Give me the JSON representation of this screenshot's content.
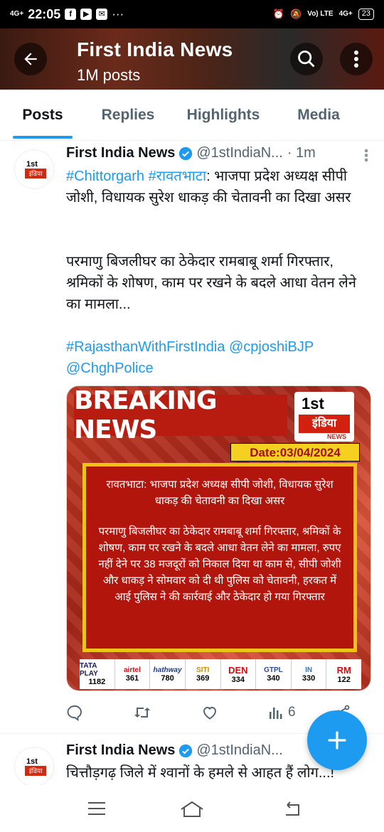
{
  "status_bar": {
    "network": "4G+",
    "time": "22:05",
    "right_network": "4G+",
    "volte": "Vo) LTE",
    "battery": "23"
  },
  "header": {
    "title": "First India News",
    "subtitle": "1M posts"
  },
  "tabs": [
    {
      "label": "Posts",
      "active": true
    },
    {
      "label": "Replies",
      "active": false
    },
    {
      "label": "Highlights",
      "active": false
    },
    {
      "label": "Media",
      "active": false
    }
  ],
  "tweet1": {
    "name": "First India News",
    "handle": "@1stIndiaN...",
    "time": "· 1m",
    "line1_tags": "#Chittorgarh #रावतभाटा",
    "line1_rest": ": भाजपा प्रदेश अध्यक्ष सीपी जोशी, विधायक सुरेश धाकड़ की चेतावनी का दिखा असर",
    "para2": "परमाणु बिजलीघर का ठेकेदार रामबाबू शर्मा गिरफ्तार, श्रमिकों के शोषण, काम पर रखने के बदले आधा वेतन लेने का मामला...",
    "hashtag3": "#RajasthanWithFirstIndia",
    "mention1": "@cpjoshiBJP",
    "mention2": "@ChghPolice",
    "views": "6"
  },
  "media": {
    "breaking": "BREAKING NEWS",
    "logo_1st": "1st",
    "logo_india": "इंडिया",
    "logo_news": "NEWS",
    "date": "Date:03/04/2024",
    "para1": "रावतभाटा: भाजपा प्रदेश अध्यक्ष सीपी जोशी, विधायक सुरेश धाकड़ की चेतावनी का दिखा असर",
    "para2": "परमाणु बिजलीघर का ठेकेदार रामबाबू शर्मा गिरफ्तार, श्रमिकों के शोषण, काम पर रखने के बदले आधा वेतन लेने का मामला, रुपए नहीं देने पर 38 मजदूरों को निकाल दिया था काम से, सीपी जोशी और धाकड़ ने सोमवार को दी थी पुलिस को चेतावनी, हरकत में आई पुलिस ने की कार्रवाई और ठेकेदार हो गया गिरफ्तार",
    "channels": [
      {
        "brand": "TATA PLAY",
        "num": "1182"
      },
      {
        "brand": "airtel",
        "num": "361"
      },
      {
        "brand": "hathway",
        "num": "780"
      },
      {
        "brand": "SITI",
        "num": "369"
      },
      {
        "brand": "DEN",
        "num": "334"
      },
      {
        "brand": "GTPL",
        "num": "340"
      },
      {
        "brand": "IN",
        "num": "330"
      },
      {
        "brand": "RM",
        "num": "122"
      }
    ]
  },
  "tweet2": {
    "name": "First India News",
    "handle": "@1stIndiaN...",
    "text": "चित्तौड़गढ़ जिले में श्वानों के हमले से आहत हैं लोग...!"
  },
  "avatar": {
    "label_1st": "1st",
    "label_india": "इंडिया"
  },
  "colors": {
    "accent": "#1d9bf0",
    "breaking_red": "#b81c10",
    "date_yellow": "#f5d020"
  }
}
